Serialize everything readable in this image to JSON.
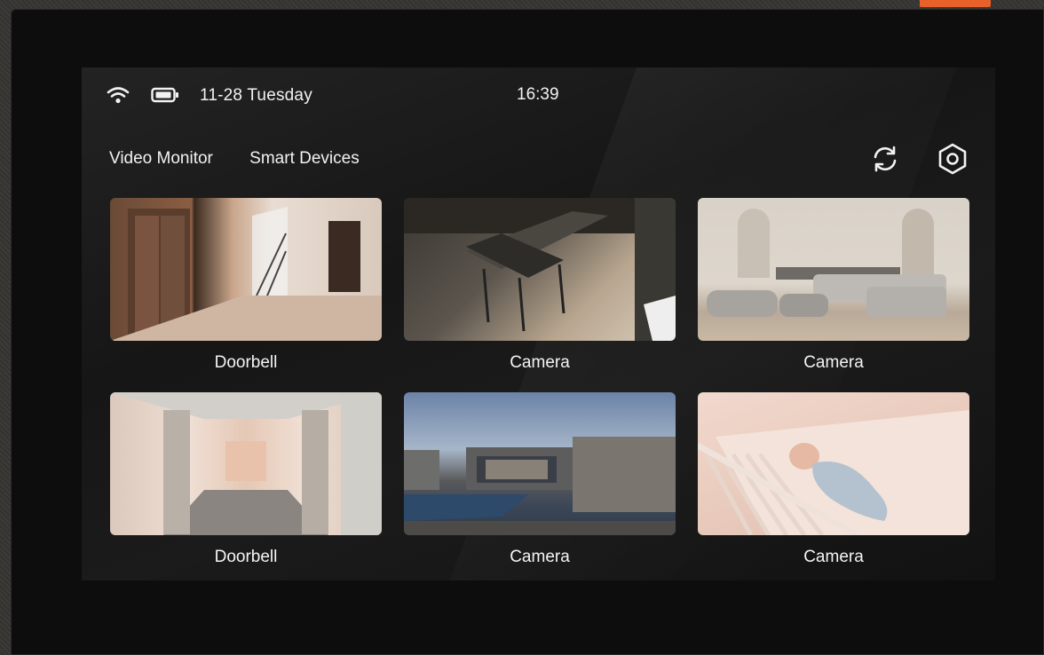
{
  "status": {
    "wifi_icon": "wifi-icon",
    "battery_icon": "battery-icon",
    "date": "11-28 Tuesday",
    "time": "16:39"
  },
  "nav": {
    "tabs": [
      {
        "label": "Video Monitor"
      },
      {
        "label": "Smart Devices"
      }
    ],
    "refresh_icon": "refresh-icon",
    "settings_icon": "settings-icon"
  },
  "tiles": [
    {
      "label": "Doorbell",
      "scene": "elevator-lobby"
    },
    {
      "label": "Camera",
      "scene": "kitchen"
    },
    {
      "label": "Camera",
      "scene": "living-room"
    },
    {
      "label": "Doorbell",
      "scene": "hallway"
    },
    {
      "label": "Camera",
      "scene": "house-exterior"
    },
    {
      "label": "Camera",
      "scene": "baby-crib"
    }
  ],
  "colors": {
    "accent_led": "#e8602a",
    "text": "#f2f2f2",
    "screen_bg": "#161616"
  }
}
